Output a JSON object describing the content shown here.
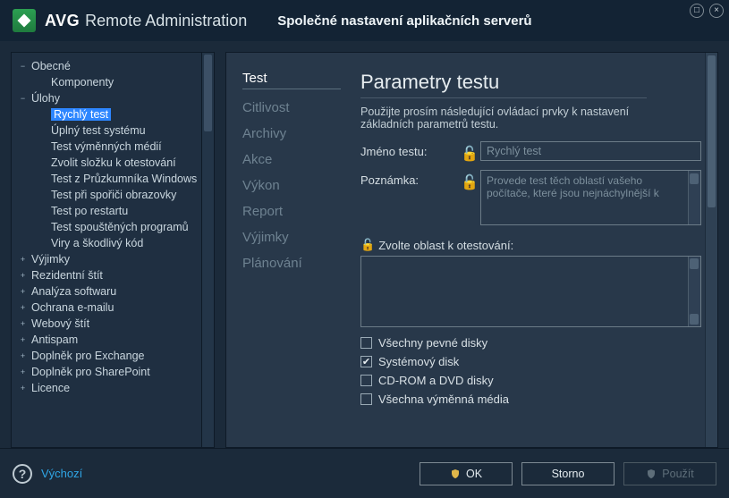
{
  "brand": {
    "major": "AVG",
    "minor": "Remote Administration"
  },
  "dialog_title": "Společné nastavení aplikačních serverů",
  "tree": [
    {
      "label": "Obecné",
      "depth": 0,
      "expander": "−"
    },
    {
      "label": "Komponenty",
      "depth": 1
    },
    {
      "label": "Úlohy",
      "depth": 0,
      "expander": "−"
    },
    {
      "label": "Rychlý test",
      "depth": 1,
      "selected": true
    },
    {
      "label": "Úplný test systému",
      "depth": 1
    },
    {
      "label": "Test výměnných médií",
      "depth": 1
    },
    {
      "label": "Zvolit složku k otestování",
      "depth": 1
    },
    {
      "label": "Test z Průzkumníka Windows",
      "depth": 1
    },
    {
      "label": "Test při spořiči obrazovky",
      "depth": 1
    },
    {
      "label": "Test po restartu",
      "depth": 1
    },
    {
      "label": "Test spouštěných programů",
      "depth": 1
    },
    {
      "label": "Viry a škodlivý kód",
      "depth": 1
    },
    {
      "label": "Výjimky",
      "depth": 0,
      "expander": "+"
    },
    {
      "label": "Rezidentní štít",
      "depth": 0,
      "expander": "+"
    },
    {
      "label": "Analýza softwaru",
      "depth": 0,
      "expander": "+"
    },
    {
      "label": "Ochrana e-mailu",
      "depth": 0,
      "expander": "+"
    },
    {
      "label": "Webový štít",
      "depth": 0,
      "expander": "+"
    },
    {
      "label": "Antispam",
      "depth": 0,
      "expander": "+"
    },
    {
      "label": "Doplněk pro Exchange",
      "depth": 0,
      "expander": "+"
    },
    {
      "label": "Doplněk pro SharePoint",
      "depth": 0,
      "expander": "+"
    },
    {
      "label": "Licence",
      "depth": 0,
      "expander": "+"
    }
  ],
  "tabs": [
    {
      "label": "Test",
      "active": true
    },
    {
      "label": "Citlivost"
    },
    {
      "label": "Archivy"
    },
    {
      "label": "Akce"
    },
    {
      "label": "Výkon"
    },
    {
      "label": "Report"
    },
    {
      "label": "Výjimky"
    },
    {
      "label": "Plánování"
    }
  ],
  "form": {
    "section_title": "Parametry testu",
    "section_sub": "Použijte prosím následující ovládací prvky k nastavení základních parametrů testu.",
    "name_label": "Jméno testu:",
    "name_value": "Rychlý test",
    "note_label": "Poznámka:",
    "note_value": "Provede test těch oblastí vašeho počítače, které jsou nejnáchylnější k",
    "area_label": "Zvolte oblast k otestování:",
    "checks": [
      {
        "label": "Všechny pevné disky",
        "checked": false
      },
      {
        "label": "Systémový disk",
        "checked": true
      },
      {
        "label": "CD-ROM a DVD disky",
        "checked": false
      },
      {
        "label": "Všechna výměnná média",
        "checked": false
      }
    ]
  },
  "footer": {
    "default_link": "Výchozí",
    "ok": "OK",
    "cancel": "Storno",
    "apply": "Použít"
  }
}
